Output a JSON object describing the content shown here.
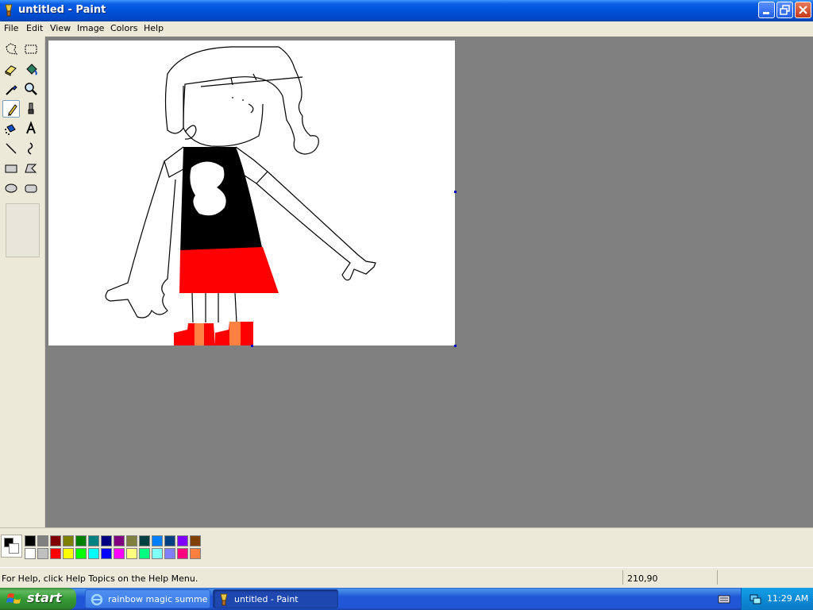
{
  "window": {
    "title": "untitled - Paint"
  },
  "menu": [
    "File",
    "Edit",
    "View",
    "Image",
    "Colors",
    "Help"
  ],
  "tools": [
    "free-form-select-icon",
    "rectangle-select-icon",
    "eraser-icon",
    "fill-bucket-icon",
    "color-picker-icon",
    "magnifier-icon",
    "pencil-icon",
    "brush-icon",
    "airbrush-icon",
    "text-icon",
    "line-icon",
    "curve-icon",
    "rectangle-icon",
    "polygon-icon",
    "ellipse-icon",
    "rounded-rectangle-icon"
  ],
  "selected_tool": "pencil-icon",
  "colors": {
    "foreground": "#000000",
    "background": "#ffffff",
    "palette_row1": [
      "#000000",
      "#808080",
      "#800000",
      "#808000",
      "#008000",
      "#008080",
      "#000080",
      "#800080",
      "#808040",
      "#004040",
      "#0080ff",
      "#004080",
      "#8000ff",
      "#804000"
    ],
    "palette_row2": [
      "#ffffff",
      "#c0c0c0",
      "#ff0000",
      "#ffff00",
      "#00ff00",
      "#00ffff",
      "#0000ff",
      "#ff00ff",
      "#ffff80",
      "#00ff80",
      "#80ffff",
      "#8080ff",
      "#ff0080",
      "#ff8040"
    ]
  },
  "status": {
    "help_text": "For Help, click Help Topics on the Help Menu.",
    "coordinates": "210,90"
  },
  "taskbar": {
    "start_label": "start",
    "items": [
      {
        "label": "rainbow magic summe...",
        "active": false
      },
      {
        "label": "untitled - Paint",
        "active": true
      }
    ],
    "clock": "11:29 AM"
  }
}
